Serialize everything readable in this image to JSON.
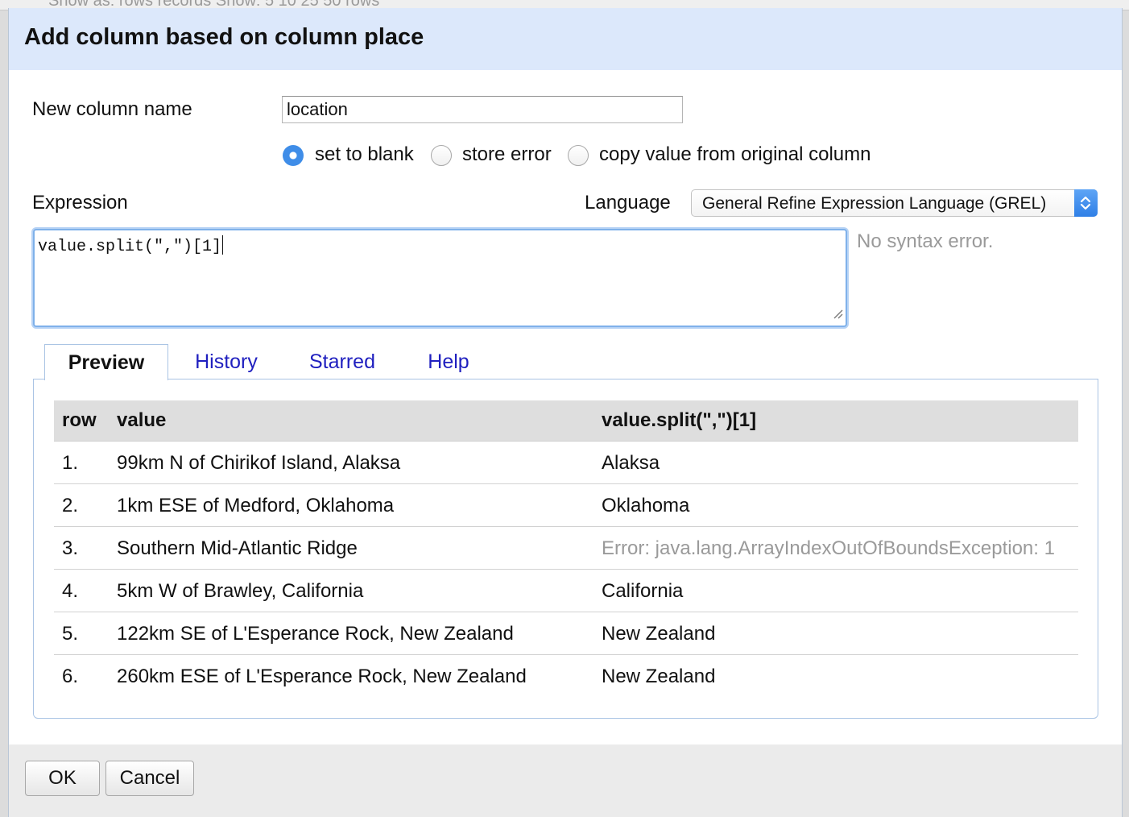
{
  "background": {
    "ghost_text": "Show as: rows records     Show: 5 10 25 50 rows"
  },
  "dialog": {
    "title": "Add column based on column place"
  },
  "form": {
    "new_column_label": "New column name",
    "new_column_value": "location",
    "on_error_options": [
      {
        "label": "set to blank",
        "checked": true
      },
      {
        "label": "store error",
        "checked": false
      },
      {
        "label": "copy value from original column",
        "checked": false
      }
    ],
    "expression_label": "Expression",
    "language_label": "Language",
    "language_selected": "General Refine Expression Language (GREL)",
    "expression": "value.split(\",\")[1]",
    "syntax_status": "No syntax error."
  },
  "tabs": [
    {
      "label": "Preview",
      "active": true
    },
    {
      "label": "History",
      "active": false
    },
    {
      "label": "Starred",
      "active": false
    },
    {
      "label": "Help",
      "active": false
    }
  ],
  "preview": {
    "headers": {
      "row": "row",
      "value": "value",
      "result": "value.split(\",\")[1]"
    },
    "rows": [
      {
        "row": "1.",
        "value": "99km N of Chirikof Island, Alaksa",
        "result": "Alaksa",
        "error": false
      },
      {
        "row": "2.",
        "value": "1km ESE of Medford, Oklahoma",
        "result": "Oklahoma",
        "error": false
      },
      {
        "row": "3.",
        "value": "Southern Mid-Atlantic Ridge",
        "result": "Error: java.lang.ArrayIndexOutOfBoundsException: 1",
        "error": true
      },
      {
        "row": "4.",
        "value": "5km W of Brawley, California",
        "result": "California",
        "error": false
      },
      {
        "row": "5.",
        "value": "122km SE of L'Esperance Rock, New Zealand",
        "result": "New Zealand",
        "error": false
      },
      {
        "row": "6.",
        "value": "260km ESE of L'Esperance Rock, New Zealand",
        "result": "New Zealand",
        "error": false
      }
    ]
  },
  "buttons": {
    "ok": "OK",
    "cancel": "Cancel"
  },
  "colors": {
    "header_bg": "#dce8fb",
    "tab_link": "#1f1fbf",
    "radio_checked": "#3f8de8",
    "error_text": "#9a9a9a"
  }
}
